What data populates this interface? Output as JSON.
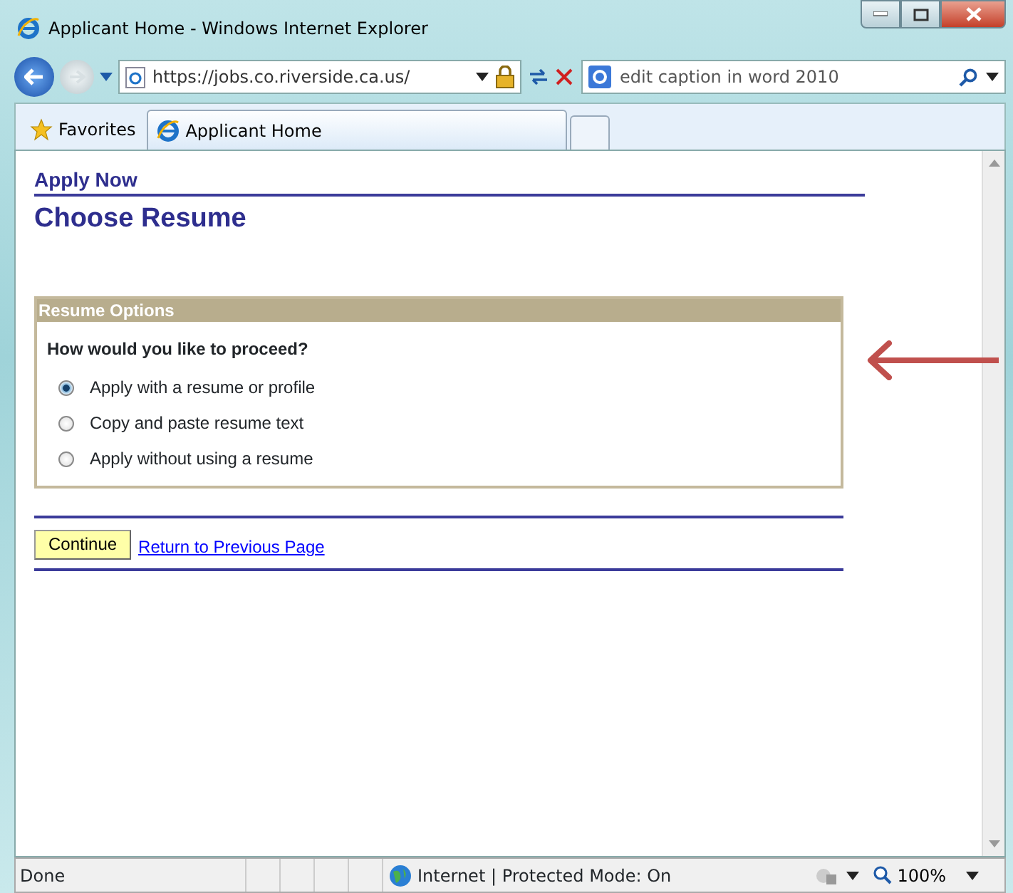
{
  "window": {
    "title": "Applicant Home - Windows Internet Explorer"
  },
  "address_bar": {
    "url": "https://jobs.co.riverside.ca.us/"
  },
  "search": {
    "value": "edit caption in word 2010"
  },
  "favorites": {
    "label": "Favorites"
  },
  "tabs": [
    {
      "label": "Applicant Home",
      "selected": true
    }
  ],
  "page": {
    "breadcrumb": "Apply Now",
    "heading": "Choose Resume",
    "section": {
      "title": "Resume Options",
      "question": "How would you like to proceed?",
      "options": [
        {
          "label": "Apply with a resume or profile",
          "selected": true
        },
        {
          "label": "Copy and paste resume text",
          "selected": false
        },
        {
          "label": "Apply without using a resume",
          "selected": false
        }
      ]
    },
    "actions": [
      {
        "kind": "button",
        "label": "Continue"
      },
      {
        "kind": "link",
        "label": "Return to Previous Page"
      }
    ]
  },
  "status_bar": {
    "text": "Done",
    "zone": "Internet | Protected Mode: On",
    "zoom": "100%"
  }
}
